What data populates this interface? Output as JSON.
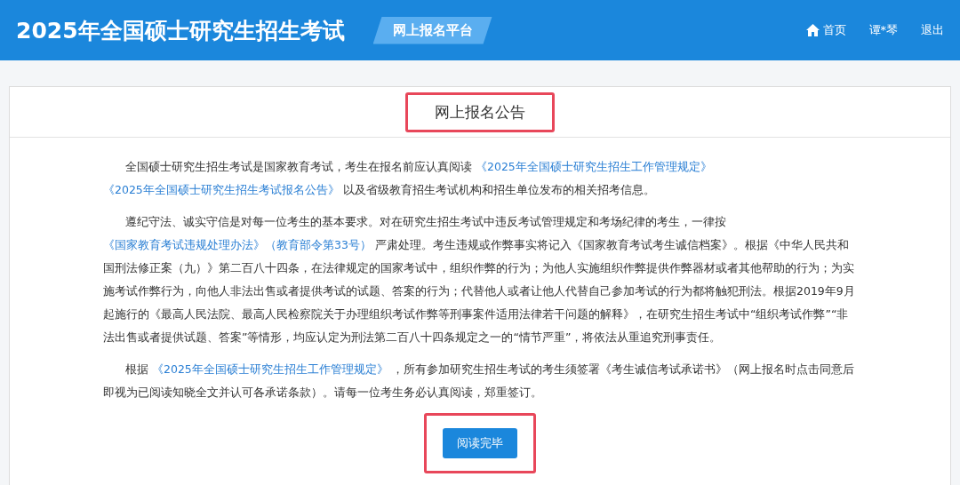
{
  "header": {
    "title": "2025年全国硕士研究生招生考试",
    "platform_tag": "网上报名平台",
    "nav": [
      {
        "kind": "home",
        "label": "首页"
      },
      {
        "kind": "user",
        "label": "谭*琴"
      },
      {
        "kind": "logout",
        "label": "退出"
      }
    ]
  },
  "notice": {
    "title": "网上报名公告",
    "title_highlighted": true,
    "paragraphs": [
      [
        {
          "kind": "text",
          "text": "全国硕士研究生招生考试是国家教育考试，考生在报名前应认真阅读 "
        },
        {
          "kind": "link",
          "text": "《2025年全国硕士研究生招生工作管理规定》"
        },
        {
          "kind": "link",
          "text": "《2025年全国硕士研究生招生考试报名公告》"
        },
        {
          "kind": "text",
          "text": "以及省级教育招生考试机构和招生单位发布的相关招考信息。"
        }
      ],
      [
        {
          "kind": "text",
          "text": "遵纪守法、诚实守信是对每一位考生的基本要求。对在研究生招生考试中违反考试管理规定和考场纪律的考生，一律按 "
        },
        {
          "kind": "link",
          "text": "《国家教育考试违规处理办法》（教育部令第33号）"
        },
        {
          "kind": "text",
          "text": "严肃处理。考生违规或作弊事实将记入《国家教育考试考生诚信档案》。根据《中华人民共和国刑法修正案（九）》第二百八十四条，在法律规定的国家考试中，组织作弊的行为；为他人实施组织作弊提供作弊器材或者其他帮助的行为；为实施考试作弊行为，向他人非法出售或者提供考试的试题、答案的行为；代替他人或者让他人代替自己参加考试的行为都将触犯刑法。根据2019年9月起施行的《最高人民法院、最高人民检察院关于办理组织考试作弊等刑事案件适用法律若干问题的解释》，在研究生招生考试中“组织考试作弊”“非法出售或者提供试题、答案”等情形，均应认定为刑法第二百八十四条规定之一的“情节严重”，将依法从重追究刑事责任。"
        }
      ],
      [
        {
          "kind": "text",
          "text": "根据 "
        },
        {
          "kind": "link",
          "text": "《2025年全国硕士研究生招生工作管理规定》"
        },
        {
          "kind": "text",
          "text": "，所有参加研究生招生考试的考生须签署《考生诚信考试承诺书》（网上报名时点击同意后即视为已阅读知晓全文并认可各承诺条款）。请每一位考生务必认真阅读，郑重签订。"
        }
      ]
    ],
    "button": {
      "label": "阅读完毕",
      "highlighted": true
    }
  }
}
